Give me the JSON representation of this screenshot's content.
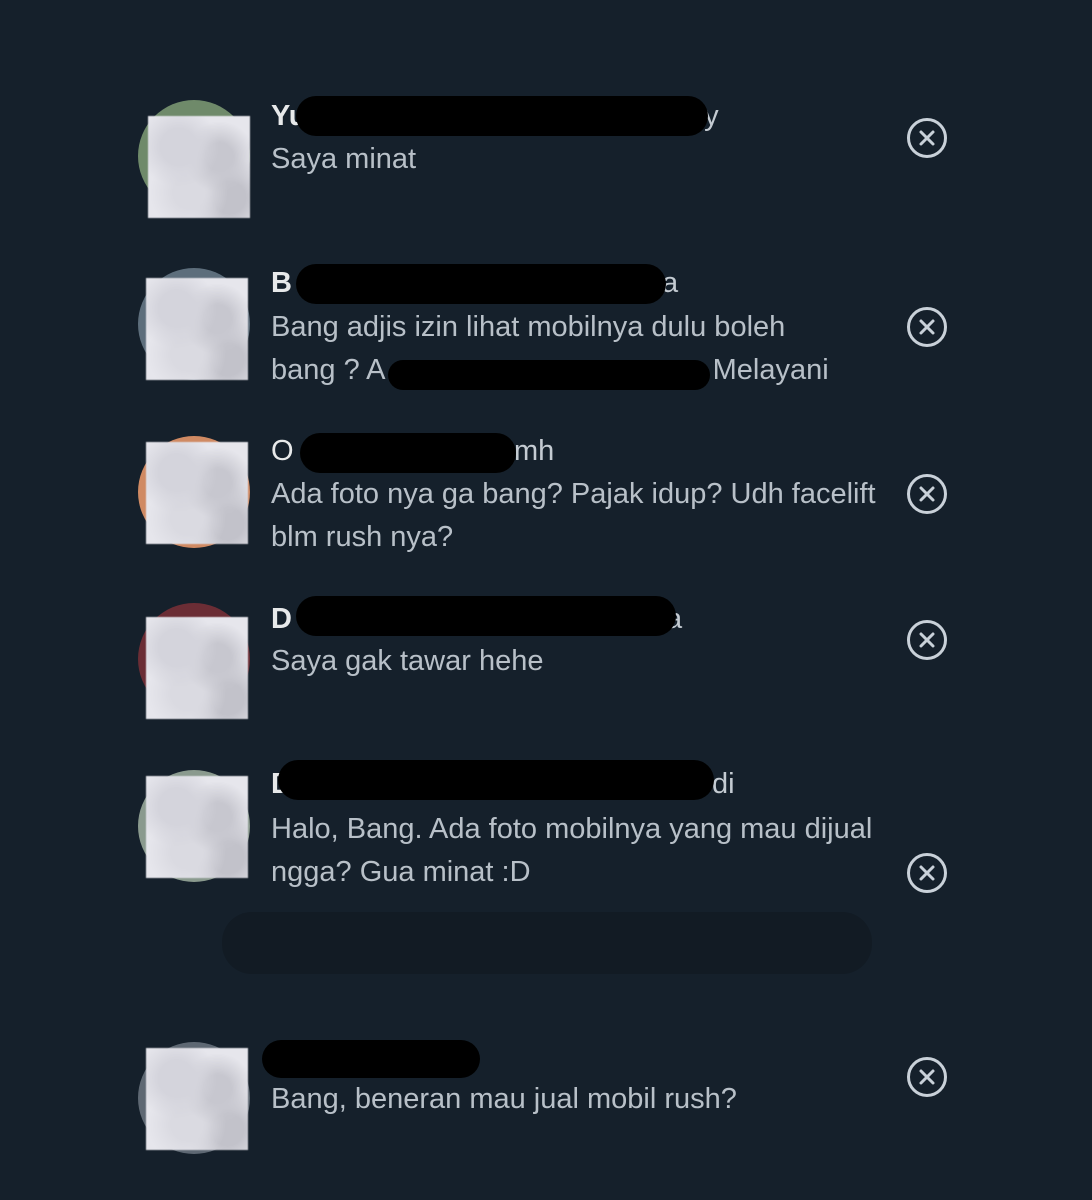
{
  "colors": {
    "background": "#15202b",
    "name_text": "#e7e9ea",
    "message_text": "#b8c0c8",
    "redaction": "#000000",
    "close_icon": "#c9d1d9"
  },
  "replies": [
    {
      "name_start": "Yu",
      "name_end": "uy",
      "message": "Saya minat",
      "avatar_tint": "#6f8a6a",
      "close_icon": "close-icon"
    },
    {
      "name_start": "B",
      "name_end": "a",
      "message_line1": "Bang adjis izin lihat mobilnya dulu boleh",
      "message_line2_start": "bang ? A",
      "message_line2_end": ". Melayani",
      "avatar_tint": "#5d6e7c",
      "close_icon": "close-icon"
    },
    {
      "name_start": "O",
      "name_end": "mh",
      "message": "Ada foto nya ga bang? Pajak idup? Udh facelift blm rush nya?",
      "avatar_tint": "#d08a63",
      "close_icon": "close-icon"
    },
    {
      "name_start": "D",
      "name_end": "a",
      "message": "Saya gak tawar hehe",
      "avatar_tint": "#6b2d35",
      "close_icon": "close-icon"
    },
    {
      "name_start": "D",
      "name_end": "di",
      "message": "Halo, Bang. Ada foto mobilnya yang mau dijual ngga? Gua minat :D",
      "avatar_tint": "#8a9a8e",
      "close_icon": "close-icon"
    },
    {
      "name_start": "",
      "name_end": "",
      "message": "Bang, beneran mau jual mobil rush?",
      "avatar_tint": "#5e6873",
      "close_icon": "close-icon"
    }
  ]
}
